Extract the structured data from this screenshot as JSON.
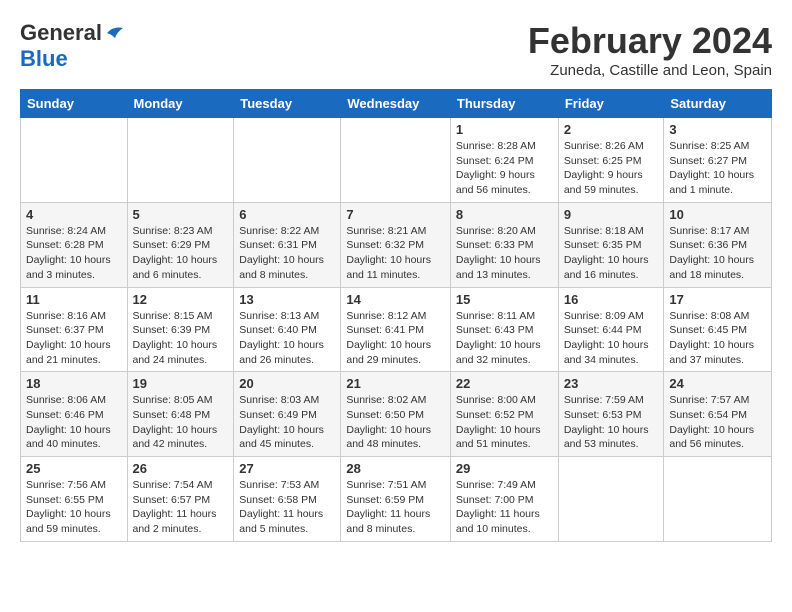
{
  "header": {
    "logo": {
      "general": "General",
      "blue": "Blue"
    },
    "title": "February 2024",
    "location": "Zuneda, Castille and Leon, Spain"
  },
  "days_of_week": [
    "Sunday",
    "Monday",
    "Tuesday",
    "Wednesday",
    "Thursday",
    "Friday",
    "Saturday"
  ],
  "weeks": [
    [
      {
        "day": "",
        "info": ""
      },
      {
        "day": "",
        "info": ""
      },
      {
        "day": "",
        "info": ""
      },
      {
        "day": "",
        "info": ""
      },
      {
        "day": "1",
        "info": "Sunrise: 8:28 AM\nSunset: 6:24 PM\nDaylight: 9 hours and 56 minutes."
      },
      {
        "day": "2",
        "info": "Sunrise: 8:26 AM\nSunset: 6:25 PM\nDaylight: 9 hours and 59 minutes."
      },
      {
        "day": "3",
        "info": "Sunrise: 8:25 AM\nSunset: 6:27 PM\nDaylight: 10 hours and 1 minute."
      }
    ],
    [
      {
        "day": "4",
        "info": "Sunrise: 8:24 AM\nSunset: 6:28 PM\nDaylight: 10 hours and 3 minutes."
      },
      {
        "day": "5",
        "info": "Sunrise: 8:23 AM\nSunset: 6:29 PM\nDaylight: 10 hours and 6 minutes."
      },
      {
        "day": "6",
        "info": "Sunrise: 8:22 AM\nSunset: 6:31 PM\nDaylight: 10 hours and 8 minutes."
      },
      {
        "day": "7",
        "info": "Sunrise: 8:21 AM\nSunset: 6:32 PM\nDaylight: 10 hours and 11 minutes."
      },
      {
        "day": "8",
        "info": "Sunrise: 8:20 AM\nSunset: 6:33 PM\nDaylight: 10 hours and 13 minutes."
      },
      {
        "day": "9",
        "info": "Sunrise: 8:18 AM\nSunset: 6:35 PM\nDaylight: 10 hours and 16 minutes."
      },
      {
        "day": "10",
        "info": "Sunrise: 8:17 AM\nSunset: 6:36 PM\nDaylight: 10 hours and 18 minutes."
      }
    ],
    [
      {
        "day": "11",
        "info": "Sunrise: 8:16 AM\nSunset: 6:37 PM\nDaylight: 10 hours and 21 minutes."
      },
      {
        "day": "12",
        "info": "Sunrise: 8:15 AM\nSunset: 6:39 PM\nDaylight: 10 hours and 24 minutes."
      },
      {
        "day": "13",
        "info": "Sunrise: 8:13 AM\nSunset: 6:40 PM\nDaylight: 10 hours and 26 minutes."
      },
      {
        "day": "14",
        "info": "Sunrise: 8:12 AM\nSunset: 6:41 PM\nDaylight: 10 hours and 29 minutes."
      },
      {
        "day": "15",
        "info": "Sunrise: 8:11 AM\nSunset: 6:43 PM\nDaylight: 10 hours and 32 minutes."
      },
      {
        "day": "16",
        "info": "Sunrise: 8:09 AM\nSunset: 6:44 PM\nDaylight: 10 hours and 34 minutes."
      },
      {
        "day": "17",
        "info": "Sunrise: 8:08 AM\nSunset: 6:45 PM\nDaylight: 10 hours and 37 minutes."
      }
    ],
    [
      {
        "day": "18",
        "info": "Sunrise: 8:06 AM\nSunset: 6:46 PM\nDaylight: 10 hours and 40 minutes."
      },
      {
        "day": "19",
        "info": "Sunrise: 8:05 AM\nSunset: 6:48 PM\nDaylight: 10 hours and 42 minutes."
      },
      {
        "day": "20",
        "info": "Sunrise: 8:03 AM\nSunset: 6:49 PM\nDaylight: 10 hours and 45 minutes."
      },
      {
        "day": "21",
        "info": "Sunrise: 8:02 AM\nSunset: 6:50 PM\nDaylight: 10 hours and 48 minutes."
      },
      {
        "day": "22",
        "info": "Sunrise: 8:00 AM\nSunset: 6:52 PM\nDaylight: 10 hours and 51 minutes."
      },
      {
        "day": "23",
        "info": "Sunrise: 7:59 AM\nSunset: 6:53 PM\nDaylight: 10 hours and 53 minutes."
      },
      {
        "day": "24",
        "info": "Sunrise: 7:57 AM\nSunset: 6:54 PM\nDaylight: 10 hours and 56 minutes."
      }
    ],
    [
      {
        "day": "25",
        "info": "Sunrise: 7:56 AM\nSunset: 6:55 PM\nDaylight: 10 hours and 59 minutes."
      },
      {
        "day": "26",
        "info": "Sunrise: 7:54 AM\nSunset: 6:57 PM\nDaylight: 11 hours and 2 minutes."
      },
      {
        "day": "27",
        "info": "Sunrise: 7:53 AM\nSunset: 6:58 PM\nDaylight: 11 hours and 5 minutes."
      },
      {
        "day": "28",
        "info": "Sunrise: 7:51 AM\nSunset: 6:59 PM\nDaylight: 11 hours and 8 minutes."
      },
      {
        "day": "29",
        "info": "Sunrise: 7:49 AM\nSunset: 7:00 PM\nDaylight: 11 hours and 10 minutes."
      },
      {
        "day": "",
        "info": ""
      },
      {
        "day": "",
        "info": ""
      }
    ]
  ]
}
